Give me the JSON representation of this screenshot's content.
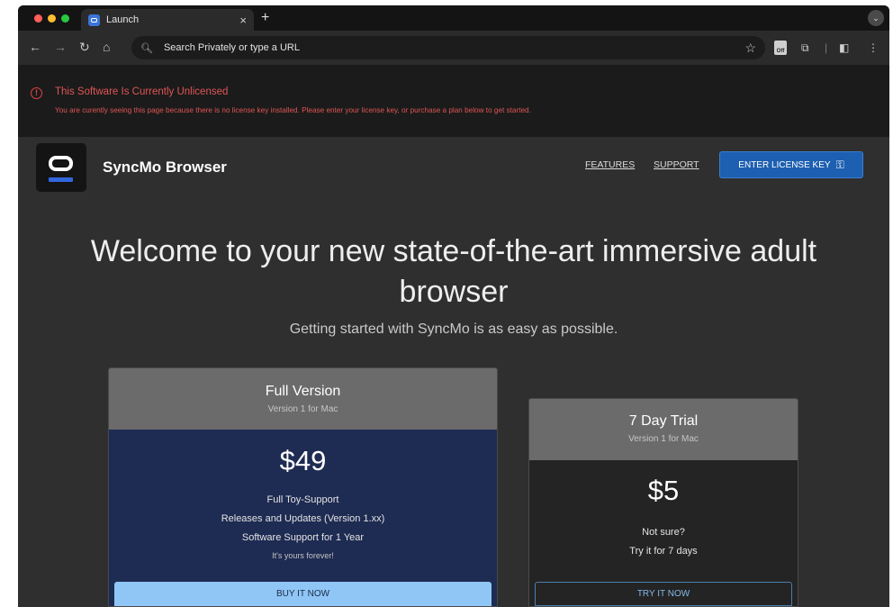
{
  "browser": {
    "tab_title": "Launch",
    "tab_close": "×",
    "new_tab": "+",
    "tab_menu": "⌄",
    "omnibox_placeholder": "Search Privately or type a URL",
    "off_badge": "Off",
    "icons": [
      "back-icon",
      "forward-icon",
      "reload-icon",
      "home-icon",
      "search-icon",
      "star-icon",
      "extensions-icon",
      "sidebar-icon",
      "menu-icon"
    ]
  },
  "banner": {
    "title": "This Software Is Currently Unlicensed",
    "text": "You are curently seeing this page because there is no license key installed. Please enter your license key, or purchase a plan below to get started."
  },
  "header": {
    "brand": "SyncMo Browser",
    "nav": [
      "FEATURES",
      "SUPPORT"
    ],
    "license_button": "ENTER LICENSE KEY",
    "accent_color": "#1d5fb0"
  },
  "hero": {
    "headline": "Welcome to your new state-of-the-art immersive adult browser",
    "subline": "Getting started with SyncMo is as easy as possible."
  },
  "plans": [
    {
      "title": "Full Version",
      "version": "Version 1 for Mac",
      "price": "$49",
      "features": [
        "Full Toy-Support",
        "Releases and Updates (Version 1.xx)",
        "Software Support for 1 Year"
      ],
      "note": "It's yours forever!",
      "button": "BUY IT NOW"
    },
    {
      "title": "7 Day Trial",
      "version": "Version 1 for Mac",
      "price": "$5",
      "features": [
        "Not sure?",
        "Try it for 7 days"
      ],
      "button": "TRY IT NOW"
    }
  ]
}
